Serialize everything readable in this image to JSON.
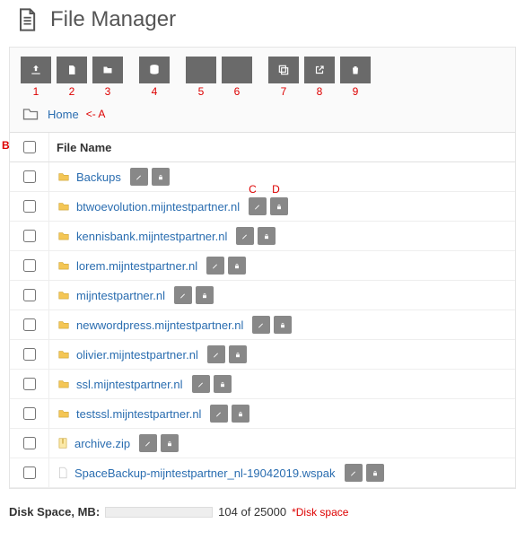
{
  "title": "File Manager",
  "toolbar_numbers": [
    "1",
    "2",
    "3",
    "4",
    "5",
    "6",
    "7",
    "8",
    "9"
  ],
  "breadcrumb": {
    "home": "Home",
    "arrow_annot": "<- A"
  },
  "annot_b": "B",
  "column_header": "File Name",
  "rows": [
    {
      "name": "Backups",
      "type": "folder"
    },
    {
      "name": "btwoevolution.mijntestpartner.nl",
      "type": "folder",
      "annot_c": "C",
      "annot_d": "D"
    },
    {
      "name": "kennisbank.mijntestpartner.nl",
      "type": "folder"
    },
    {
      "name": "lorem.mijntestpartner.nl",
      "type": "folder"
    },
    {
      "name": "mijntestpartner.nl",
      "type": "folder"
    },
    {
      "name": "newwordpress.mijntestpartner.nl",
      "type": "folder"
    },
    {
      "name": "olivier.mijntestpartner.nl",
      "type": "folder"
    },
    {
      "name": "ssl.mijntestpartner.nl",
      "type": "folder"
    },
    {
      "name": "testssl.mijntestpartner.nl",
      "type": "folder"
    },
    {
      "name": "archive.zip",
      "type": "zip"
    },
    {
      "name": "SpaceBackup-mijntestpartner_nl-19042019.wspak",
      "type": "file"
    }
  ],
  "disk": {
    "label": "Disk Space, MB:",
    "text": "104 of 25000",
    "annot": "*Disk space"
  }
}
